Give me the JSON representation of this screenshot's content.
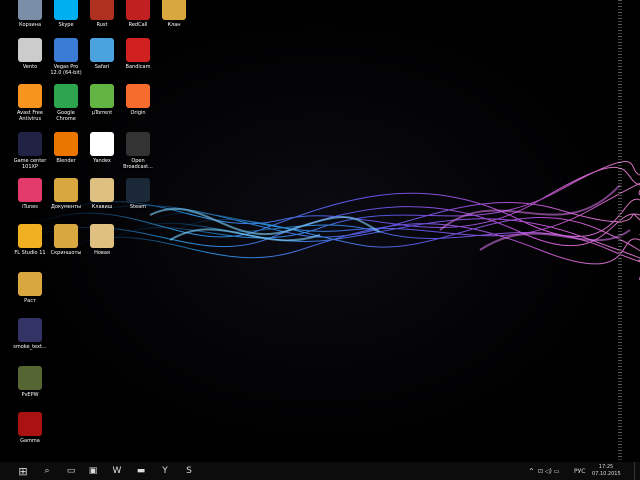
{
  "desktop": {
    "icons": [
      {
        "label": "Корзина",
        "icon": "recycle-bin-icon",
        "color": "#7a8ea8"
      },
      {
        "label": "Skype",
        "icon": "skype-icon",
        "color": "#00aff0"
      },
      {
        "label": "Rust",
        "icon": "rust-icon",
        "color": "#b03020"
      },
      {
        "label": "RedCall",
        "icon": "redcall-icon",
        "color": "#c02020"
      },
      {
        "label": "Клан",
        "icon": "folder-icon",
        "color": "#d9a740"
      },
      {
        "label": "Vento",
        "icon": "vento-icon",
        "color": "#cccccc"
      },
      {
        "label": "Vegas Pro 12.0 (64-bit)",
        "icon": "vegas-icon",
        "color": "#3a7bd5"
      },
      {
        "label": "Safari",
        "icon": "safari-icon",
        "color": "#4aa3df"
      },
      {
        "label": "Bandicam",
        "icon": "bandicam-icon",
        "color": "#d02020"
      },
      {
        "label": "Avast Free Antivirus",
        "icon": "avast-icon",
        "color": "#f7941d"
      },
      {
        "label": "Google Chrome",
        "icon": "chrome-icon",
        "color": "#2da44e"
      },
      {
        "label": "µTorrent",
        "icon": "utorrent-icon",
        "color": "#62b543"
      },
      {
        "label": "Origin",
        "icon": "origin-icon",
        "color": "#f56c2d"
      },
      {
        "label": "Game center 101XP",
        "icon": "game-center-icon",
        "color": "#222244"
      },
      {
        "label": "Blender",
        "icon": "blender-icon",
        "color": "#ea7600"
      },
      {
        "label": "Yandex",
        "icon": "yandex-icon",
        "color": "#ffffff"
      },
      {
        "label": "Open Broadcast...",
        "icon": "obs-icon",
        "color": "#333333"
      },
      {
        "label": "iTunes",
        "icon": "itunes-icon",
        "color": "#e23a6a"
      },
      {
        "label": "Документы",
        "icon": "folder-icon",
        "color": "#d9a740"
      },
      {
        "label": "Клавиш",
        "icon": "folder-icon",
        "color": "#e0c080"
      },
      {
        "label": "Steam",
        "icon": "steam-icon",
        "color": "#1b2838"
      },
      {
        "label": "FL Studio 11",
        "icon": "fl-studio-icon",
        "color": "#f0b020"
      },
      {
        "label": "Скриншоты",
        "icon": "folder-icon",
        "color": "#d9a740"
      },
      {
        "label": "Новая",
        "icon": "folder-icon",
        "color": "#e0c080"
      },
      {
        "label": "Раст",
        "icon": "folder-icon",
        "color": "#d9a740"
      },
      {
        "label": "smoke_text...",
        "icon": "file-icon",
        "color": "#333366"
      },
      {
        "label": "PvEPW",
        "icon": "pvepw-icon",
        "color": "#556633"
      },
      {
        "label": "Gamma",
        "icon": "gamma-icon",
        "color": "#aa1111"
      }
    ]
  },
  "taskbar": {
    "start": "⊞",
    "search": "⌕",
    "taskview": "▭",
    "apps": [
      {
        "name": "store-icon",
        "glyph": "▣"
      },
      {
        "name": "word-icon",
        "glyph": "W"
      },
      {
        "name": "explorer-icon",
        "glyph": "▬"
      },
      {
        "name": "yandex-taskbar-icon",
        "glyph": "Y"
      },
      {
        "name": "skype-taskbar-icon",
        "glyph": "S"
      }
    ],
    "tray_chevron": "⌃",
    "tray_icons": "⊡ ◁) ▭",
    "language": "РУС",
    "time": "17:25",
    "date": "07.10.2015"
  }
}
